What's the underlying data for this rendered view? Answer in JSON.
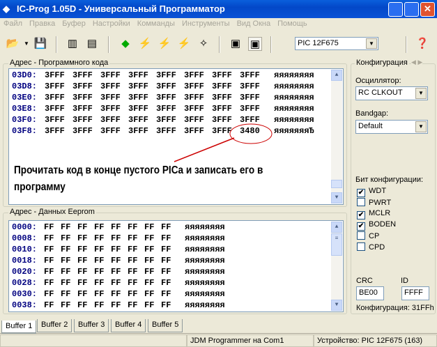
{
  "title": "IC-Prog 1.05D - Универсальный Программатор",
  "menu": [
    "Файл",
    "Правка",
    "Буфер",
    "Настройки",
    "Комманды",
    "Инструменты",
    "Вид Окна",
    "Помощь"
  ],
  "device_select": "PIC 12F675",
  "code_panel": {
    "label": "Адрес - Программного кода",
    "rows": [
      {
        "addr": "03D0:",
        "values": [
          "3FFF",
          "3FFF",
          "3FFF",
          "3FFF",
          "3FFF",
          "3FFF",
          "3FFF",
          "3FFF"
        ],
        "ascii": "яяяяяяяя"
      },
      {
        "addr": "03D8:",
        "values": [
          "3FFF",
          "3FFF",
          "3FFF",
          "3FFF",
          "3FFF",
          "3FFF",
          "3FFF",
          "3FFF"
        ],
        "ascii": "яяяяяяяя"
      },
      {
        "addr": "03E0:",
        "values": [
          "3FFF",
          "3FFF",
          "3FFF",
          "3FFF",
          "3FFF",
          "3FFF",
          "3FFF",
          "3FFF"
        ],
        "ascii": "яяяяяяяя"
      },
      {
        "addr": "03E8:",
        "values": [
          "3FFF",
          "3FFF",
          "3FFF",
          "3FFF",
          "3FFF",
          "3FFF",
          "3FFF",
          "3FFF"
        ],
        "ascii": "яяяяяяяя"
      },
      {
        "addr": "03F0:",
        "values": [
          "3FFF",
          "3FFF",
          "3FFF",
          "3FFF",
          "3FFF",
          "3FFF",
          "3FFF",
          "3FFF"
        ],
        "ascii": "яяяяяяяя"
      },
      {
        "addr": "03F8:",
        "values": [
          "3FFF",
          "3FFF",
          "3FFF",
          "3FFF",
          "3FFF",
          "3FFF",
          "3FFF",
          "3480"
        ],
        "ascii": "яяяяяяяЂ"
      }
    ]
  },
  "annotation": {
    "line1": "Прочитать код в конце пустого PICa и записать его в",
    "line2": "программу",
    "color": "#cc0000"
  },
  "eeprom_panel": {
    "label": "Адрес - Данных Eeprom",
    "rows": [
      {
        "addr": "0000:",
        "values": [
          "FF",
          "FF",
          "FF",
          "FF",
          "FF",
          "FF",
          "FF",
          "FF"
        ],
        "ascii": "яяяяяяяя"
      },
      {
        "addr": "0008:",
        "values": [
          "FF",
          "FF",
          "FF",
          "FF",
          "FF",
          "FF",
          "FF",
          "FF"
        ],
        "ascii": "яяяяяяяя"
      },
      {
        "addr": "0010:",
        "values": [
          "FF",
          "FF",
          "FF",
          "FF",
          "FF",
          "FF",
          "FF",
          "FF"
        ],
        "ascii": "яяяяяяяя"
      },
      {
        "addr": "0018:",
        "values": [
          "FF",
          "FF",
          "FF",
          "FF",
          "FF",
          "FF",
          "FF",
          "FF"
        ],
        "ascii": "яяяяяяяя"
      },
      {
        "addr": "0020:",
        "values": [
          "FF",
          "FF",
          "FF",
          "FF",
          "FF",
          "FF",
          "FF",
          "FF"
        ],
        "ascii": "яяяяяяяя"
      },
      {
        "addr": "0028:",
        "values": [
          "FF",
          "FF",
          "FF",
          "FF",
          "FF",
          "FF",
          "FF",
          "FF"
        ],
        "ascii": "яяяяяяяя"
      },
      {
        "addr": "0030:",
        "values": [
          "FF",
          "FF",
          "FF",
          "FF",
          "FF",
          "FF",
          "FF",
          "FF"
        ],
        "ascii": "яяяяяяяя"
      },
      {
        "addr": "0038:",
        "values": [
          "FF",
          "FF",
          "FF",
          "FF",
          "FF",
          "FF",
          "FF",
          "FF"
        ],
        "ascii": "яяяяяяяя"
      }
    ]
  },
  "config": {
    "label": "Конфигурация",
    "osc_label": "Осциллятор:",
    "osc_value": "RC CLKOUT",
    "bandgap_label": "Bandgap:",
    "bandgap_value": "Default",
    "bits_label": "Бит конфигурации:",
    "bits": [
      {
        "name": "WDT",
        "checked": true
      },
      {
        "name": "PWRT",
        "checked": false
      },
      {
        "name": "MCLR",
        "checked": true
      },
      {
        "name": "BODEN",
        "checked": true
      },
      {
        "name": "CP",
        "checked": false
      },
      {
        "name": "CPD",
        "checked": false
      }
    ],
    "crc_label": "CRC",
    "crc_value": "BE00",
    "id_label": "ID",
    "id_value": "FFFF",
    "config_word": "Конфигурация: 31FFh"
  },
  "tabs": [
    "Buffer 1",
    "Buffer 2",
    "Buffer 3",
    "Buffer 4",
    "Buffer 5"
  ],
  "status": {
    "programmer": "JDM Programmer на Com1",
    "device": "Устройство: PIC 12F675  (163)"
  }
}
